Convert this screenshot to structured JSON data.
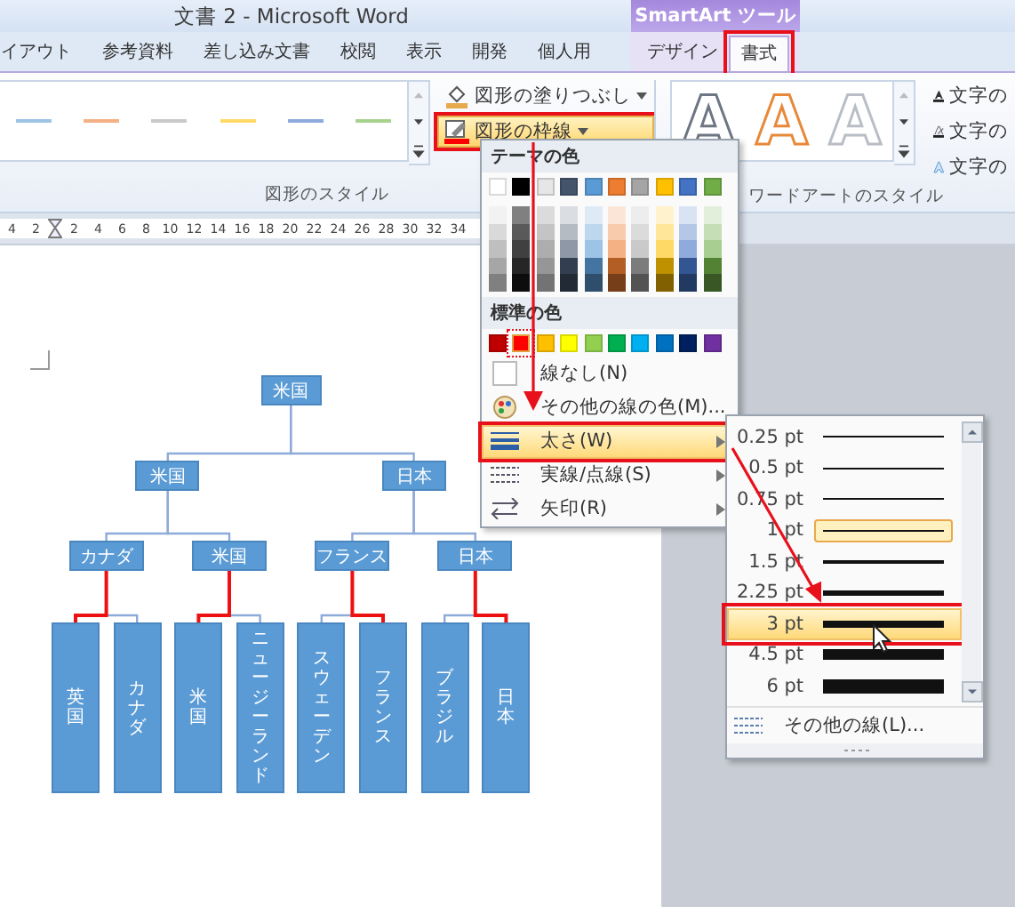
{
  "window": {
    "title": "文書 2 - Microsoft Word"
  },
  "tabs": [
    {
      "label": "イアウト",
      "selected": false
    },
    {
      "label": "参考資料",
      "selected": false
    },
    {
      "label": "差し込み文書",
      "selected": false
    },
    {
      "label": "校閲",
      "selected": false
    },
    {
      "label": "表示",
      "selected": false
    },
    {
      "label": "開発",
      "selected": false
    },
    {
      "label": "個人用",
      "selected": false
    }
  ],
  "contextual_tabs": {
    "label": "SmartArt ツール",
    "tabs": [
      {
        "label": "デザイン",
        "selected": false,
        "annotated": false
      },
      {
        "label": "書式",
        "selected": true,
        "annotated": true
      }
    ]
  },
  "ribbon": {
    "shape_styles": {
      "group_label": "図形のスタイル",
      "gallery": [
        {
          "color": "#9dc3e6"
        },
        {
          "color": "#f4b183"
        },
        {
          "color": "#c9c9c9"
        },
        {
          "color": "#ffd966"
        },
        {
          "color": "#8faadc"
        },
        {
          "color": "#a9d18e"
        }
      ],
      "buttons": [
        {
          "label": "図形の塗りつぶし",
          "kind": "fill",
          "active": false,
          "annotated": false
        },
        {
          "label": "図形の枠線",
          "kind": "outline",
          "active": true,
          "annotated": true
        }
      ]
    },
    "wordart_styles": {
      "group_label": "ワードアートのスタイル",
      "gallery": [
        {
          "glyph": "A",
          "kind": "gray"
        },
        {
          "glyph": "A",
          "kind": "orange"
        },
        {
          "glyph": "A",
          "kind": "white"
        }
      ],
      "buttons": [
        {
          "label": "文字の",
          "kind": "fill"
        },
        {
          "label": "文字の",
          "kind": "outline"
        },
        {
          "label": "文字の",
          "kind": "effects"
        }
      ]
    }
  },
  "ruler": {
    "labels": [
      "4",
      "2",
      "2",
      "4",
      "6",
      "8",
      "10",
      "12",
      "14",
      "16",
      "18",
      "20",
      "22",
      "24",
      "26",
      "28",
      "30",
      "32",
      "34"
    ]
  },
  "outline_menu": {
    "theme_header": "テーマの色",
    "theme_colors": [
      {
        "color": "#ffffff"
      },
      {
        "color": "#000000"
      },
      {
        "color": "#e7e6e6"
      },
      {
        "color": "#44546a"
      },
      {
        "color": "#5b9bd5"
      },
      {
        "color": "#ed7d31"
      },
      {
        "color": "#a5a5a5"
      },
      {
        "color": "#ffc000"
      },
      {
        "color": "#4472c4"
      },
      {
        "color": "#70ad47"
      }
    ],
    "standard_header": "標準の色",
    "standard_colors": [
      {
        "color": "#c00000",
        "selected": false
      },
      {
        "color": "#ff0000",
        "selected": true
      },
      {
        "color": "#ffc000",
        "selected": false
      },
      {
        "color": "#ffff00",
        "selected": false
      },
      {
        "color": "#92d050",
        "selected": false
      },
      {
        "color": "#00b050",
        "selected": false
      },
      {
        "color": "#00b0f0",
        "selected": false
      },
      {
        "color": "#0070c0",
        "selected": false
      },
      {
        "color": "#002060",
        "selected": false
      },
      {
        "color": "#7030a0",
        "selected": false
      }
    ],
    "items": [
      {
        "label": "線なし(N)",
        "kind": "no-line",
        "highlighted": false,
        "submenu": false,
        "annotated": false
      },
      {
        "label": "その他の線の色(M)...",
        "kind": "more-colors",
        "highlighted": false,
        "submenu": false,
        "annotated": false
      },
      {
        "label": "太さ(W)",
        "kind": "weight",
        "highlighted": true,
        "submenu": true,
        "annotated": true
      },
      {
        "label": "実線/点線(S)",
        "kind": "dashes",
        "highlighted": false,
        "submenu": true,
        "annotated": false
      },
      {
        "label": "矢印(R)",
        "kind": "arrows",
        "highlighted": false,
        "submenu": true,
        "annotated": false
      }
    ]
  },
  "weight_menu": {
    "items": [
      {
        "label": "0.25 pt",
        "selected": false,
        "hovered": false,
        "annotated": false
      },
      {
        "label": "0.5 pt",
        "selected": false,
        "hovered": false,
        "annotated": false
      },
      {
        "label": "0.75 pt",
        "selected": false,
        "hovered": false,
        "annotated": false
      },
      {
        "label": "1 pt",
        "selected": true,
        "hovered": false,
        "annotated": false
      },
      {
        "label": "1.5 pt",
        "selected": false,
        "hovered": false,
        "annotated": false
      },
      {
        "label": "2.25 pt",
        "selected": false,
        "hovered": false,
        "annotated": false
      },
      {
        "label": "3 pt",
        "selected": false,
        "hovered": true,
        "annotated": true
      },
      {
        "label": "4.5 pt",
        "selected": false,
        "hovered": false,
        "annotated": false
      },
      {
        "label": "6 pt",
        "selected": false,
        "hovered": false,
        "annotated": false
      }
    ],
    "more": "その他の線(L)..."
  },
  "diagram": {
    "root": {
      "label": "米国",
      "children": [
        {
          "label": "米国",
          "line_highlighted": false,
          "children": [
            {
              "label": "カナダ",
              "line_highlighted": false,
              "children": [
                {
                  "label": "英国",
                  "line_highlighted": true
                },
                {
                  "label": "カナダ",
                  "line_highlighted": false
                }
              ]
            },
            {
              "label": "米国",
              "line_highlighted": false,
              "children": [
                {
                  "label": "米国",
                  "line_highlighted": true
                },
                {
                  "label": "ニュージーランド",
                  "line_highlighted": false
                }
              ]
            }
          ]
        },
        {
          "label": "日本",
          "line_highlighted": false,
          "children": [
            {
              "label": "フランス",
              "line_highlighted": false,
              "children": [
                {
                  "label": "スウェーデン",
                  "line_highlighted": false
                },
                {
                  "label": "フランス",
                  "line_highlighted": true
                }
              ]
            },
            {
              "label": "日本",
              "line_highlighted": false,
              "children": [
                {
                  "label": "ブラジル",
                  "line_highlighted": false
                },
                {
                  "label": "日本",
                  "line_highlighted": true
                }
              ]
            }
          ]
        }
      ]
    }
  }
}
